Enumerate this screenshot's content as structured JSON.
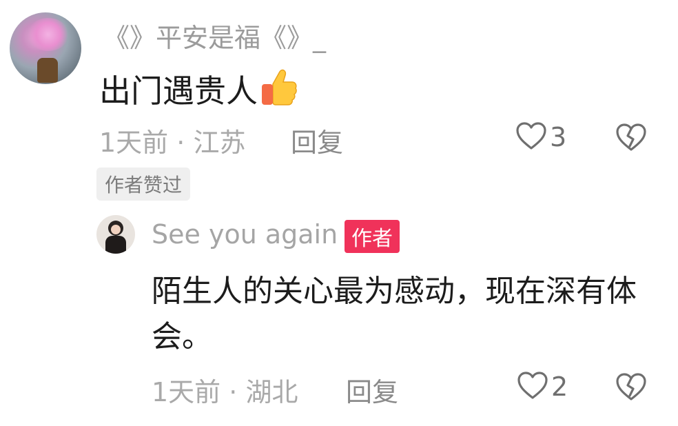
{
  "comment": {
    "username": "《》平安是福《》_",
    "text": "出门遇贵人",
    "emoji": "thumbs-up",
    "time": "1天前",
    "separator": "·",
    "location": "江苏",
    "reply_label": "回复",
    "like_count": "3",
    "badge": "作者赞过",
    "reply": {
      "username": "See you again",
      "author_tag": "作者",
      "text": "陌生人的关心最为感动，现在深有体会。",
      "time": "1天前",
      "separator": "·",
      "location": "湖北",
      "reply_label": "回复",
      "like_count": "2"
    }
  },
  "icons": {
    "like": "heart-outline-icon",
    "dislike": "broken-heart-icon"
  },
  "colors": {
    "author_tag_bg": "#f0325a",
    "badge_bg": "#efefef",
    "meta_text": "#a9a9a9"
  }
}
